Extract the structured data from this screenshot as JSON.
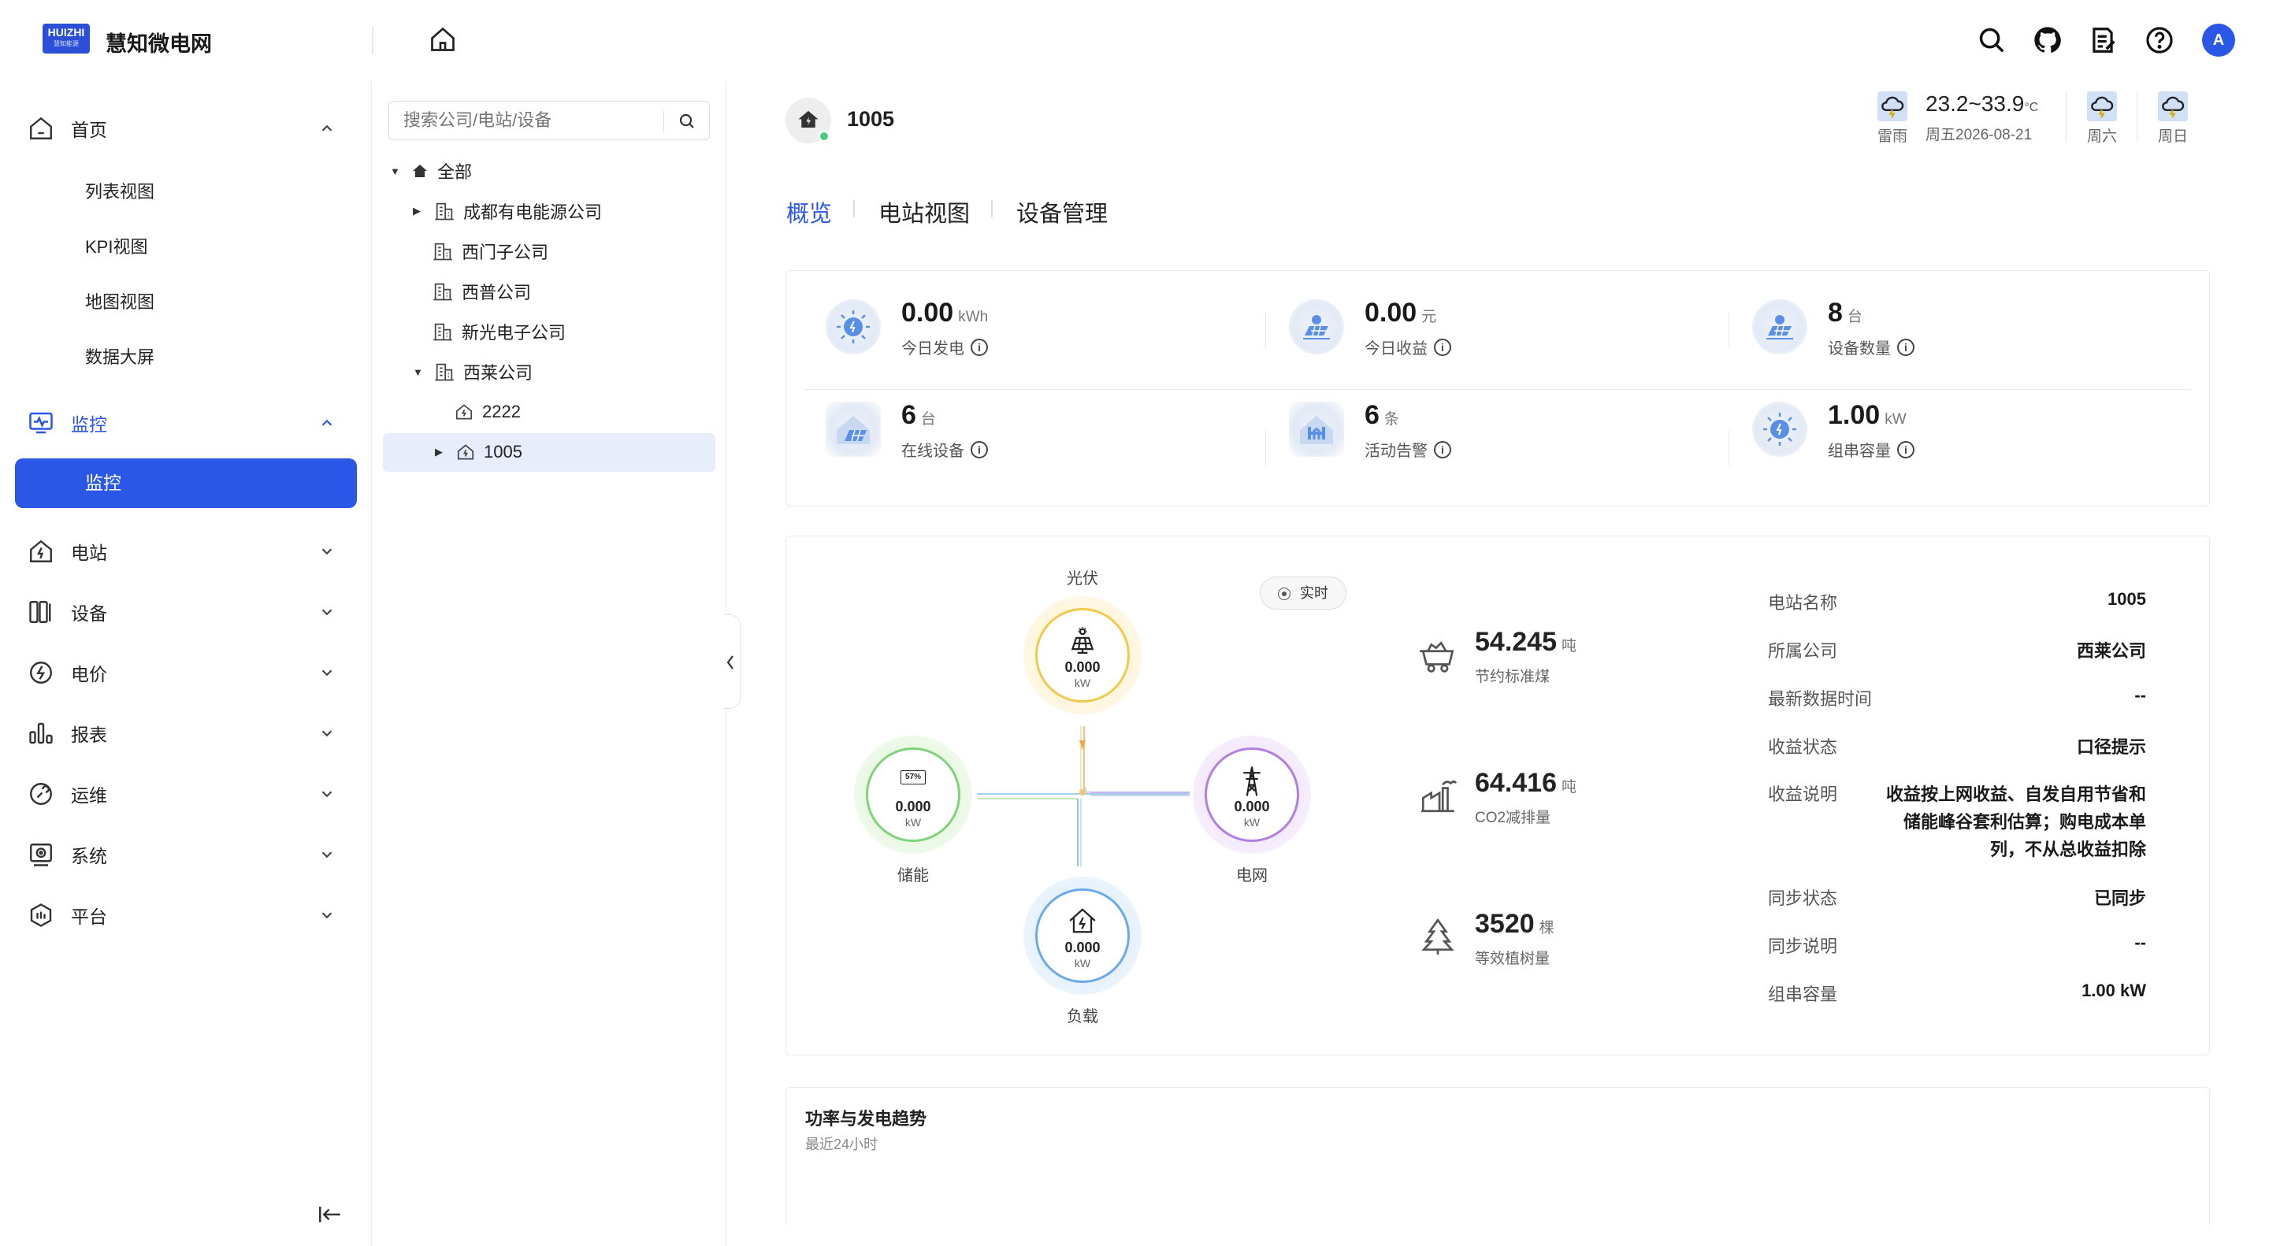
{
  "brand": {
    "logo_text": "HUIZHI",
    "logo_sub": "慧知能源",
    "name": "慧知微电网"
  },
  "header": {
    "avatar": "A",
    "icons": [
      "search-icon",
      "github-icon",
      "note-icon",
      "help-icon"
    ]
  },
  "sidebar": {
    "home": {
      "label": "首页",
      "children": [
        "列表视图",
        "KPI视图",
        "地图视图",
        "数据大屏"
      ]
    },
    "monitor": {
      "label": "监控",
      "active_child": "监控"
    },
    "items": [
      {
        "label": "电站",
        "icon": "station-icon"
      },
      {
        "label": "设备",
        "icon": "device-icon"
      },
      {
        "label": "电价",
        "icon": "price-icon"
      },
      {
        "label": "报表",
        "icon": "report-icon"
      },
      {
        "label": "运维",
        "icon": "maintenance-icon"
      },
      {
        "label": "系统",
        "icon": "system-icon"
      },
      {
        "label": "平台",
        "icon": "platform-icon"
      }
    ]
  },
  "tree": {
    "search_placeholder": "搜索公司/电站/设备",
    "root": "全部",
    "companies": [
      "成都有电能源公司",
      "西门子公司",
      "西普公司",
      "新光电子公司",
      "西莱公司"
    ],
    "stations": [
      "2222",
      "1005"
    ]
  },
  "station": {
    "name": "1005"
  },
  "weather": {
    "today": {
      "label": "雷雨",
      "temp": "23.2~33.9",
      "unit": "°C",
      "date": "周五2026-08-21"
    },
    "days": [
      "周六",
      "周日"
    ]
  },
  "tabs": [
    "概览",
    "电站视图",
    "设备管理"
  ],
  "stats": [
    {
      "value": "0.00",
      "unit": "kWh",
      "name": "今日发电"
    },
    {
      "value": "0.00",
      "unit": "元",
      "name": "今日收益"
    },
    {
      "value": "8",
      "unit": "台",
      "name": "设备数量"
    },
    {
      "value": "6",
      "unit": "台",
      "name": "在线设备"
    },
    {
      "value": "6",
      "unit": "条",
      "name": "活动告警"
    },
    {
      "value": "1.00",
      "unit": "kW",
      "name": "组串容量"
    }
  ],
  "flow": {
    "realtime_label": "实时",
    "pv": {
      "label": "光伏",
      "value": "0.000",
      "unit": "kW"
    },
    "storage": {
      "label": "储能",
      "value": "0.000",
      "unit": "kW",
      "soc": "57%"
    },
    "grid": {
      "label": "电网",
      "value": "0.000",
      "unit": "kW"
    },
    "load": {
      "label": "负载",
      "value": "0.000",
      "unit": "kW"
    }
  },
  "eco": [
    {
      "value": "54.245",
      "unit": "吨",
      "name": "节约标准煤"
    },
    {
      "value": "64.416",
      "unit": "吨",
      "name": "CO2减排量"
    },
    {
      "value": "3520",
      "unit": "棵",
      "name": "等效植树量"
    }
  ],
  "details": {
    "station_name_k": "电站名称",
    "station_name_v": "1005",
    "company_k": "所属公司",
    "company_v": "西莱公司",
    "latest_k": "最新数据时间",
    "latest_v": "--",
    "revenue_status_k": "收益状态",
    "revenue_status_v": "口径提示",
    "revenue_desc_k": "收益说明",
    "revenue_desc_l1": "收益按上网收益、自发自用节省和",
    "revenue_desc_l2": "储能峰谷套利估算；购电成本单",
    "revenue_desc_l3": "列，不从总收益扣除",
    "sync_status_k": "同步状态",
    "sync_status_v": "已同步",
    "sync_desc_k": "同步说明",
    "sync_desc_v": "--",
    "capacity_k": "组串容量",
    "capacity_v": "1.00 kW"
  },
  "trend": {
    "title": "功率与发电趋势",
    "subtitle": "最近24小时"
  },
  "colors": {
    "accent": "#2b57e6",
    "pv": "#f2c94c",
    "storage": "#7fd37a",
    "grid": "#b07fe0",
    "load": "#6aa9ec"
  }
}
